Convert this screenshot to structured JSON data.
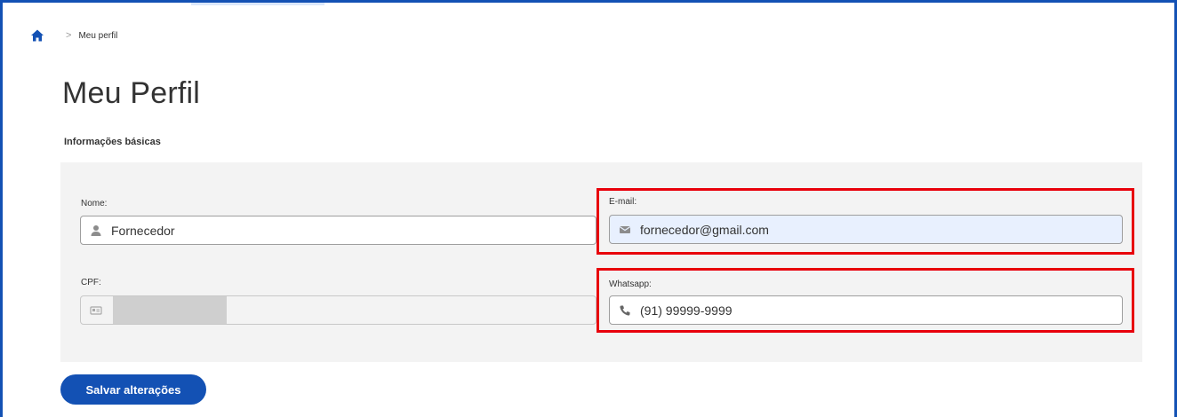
{
  "breadcrumb": {
    "home_icon": "home-icon",
    "separator": ">",
    "current": "Meu perfil"
  },
  "page": {
    "title": "Meu Perfil",
    "section_title": "Informações básicas"
  },
  "form": {
    "nome": {
      "label": "Nome:",
      "value": "Fornecedor",
      "icon": "user-icon"
    },
    "email": {
      "label": "E-mail:",
      "value": "fornecedor@gmail.com",
      "icon": "envelope-icon",
      "highlighted": true
    },
    "cpf": {
      "label": "CPF:",
      "value": "",
      "icon": "id-card-icon",
      "disabled": true,
      "redacted": true
    },
    "whatsapp": {
      "label": "Whatsapp:",
      "value": "(91) 99999-9999",
      "icon": "phone-icon",
      "highlighted": true
    }
  },
  "actions": {
    "save_label": "Salvar alterações"
  },
  "colors": {
    "primary": "#1351b4",
    "highlight": "#e8000b",
    "panel": "#f3f3f3",
    "autofill": "#e8f0fe"
  }
}
